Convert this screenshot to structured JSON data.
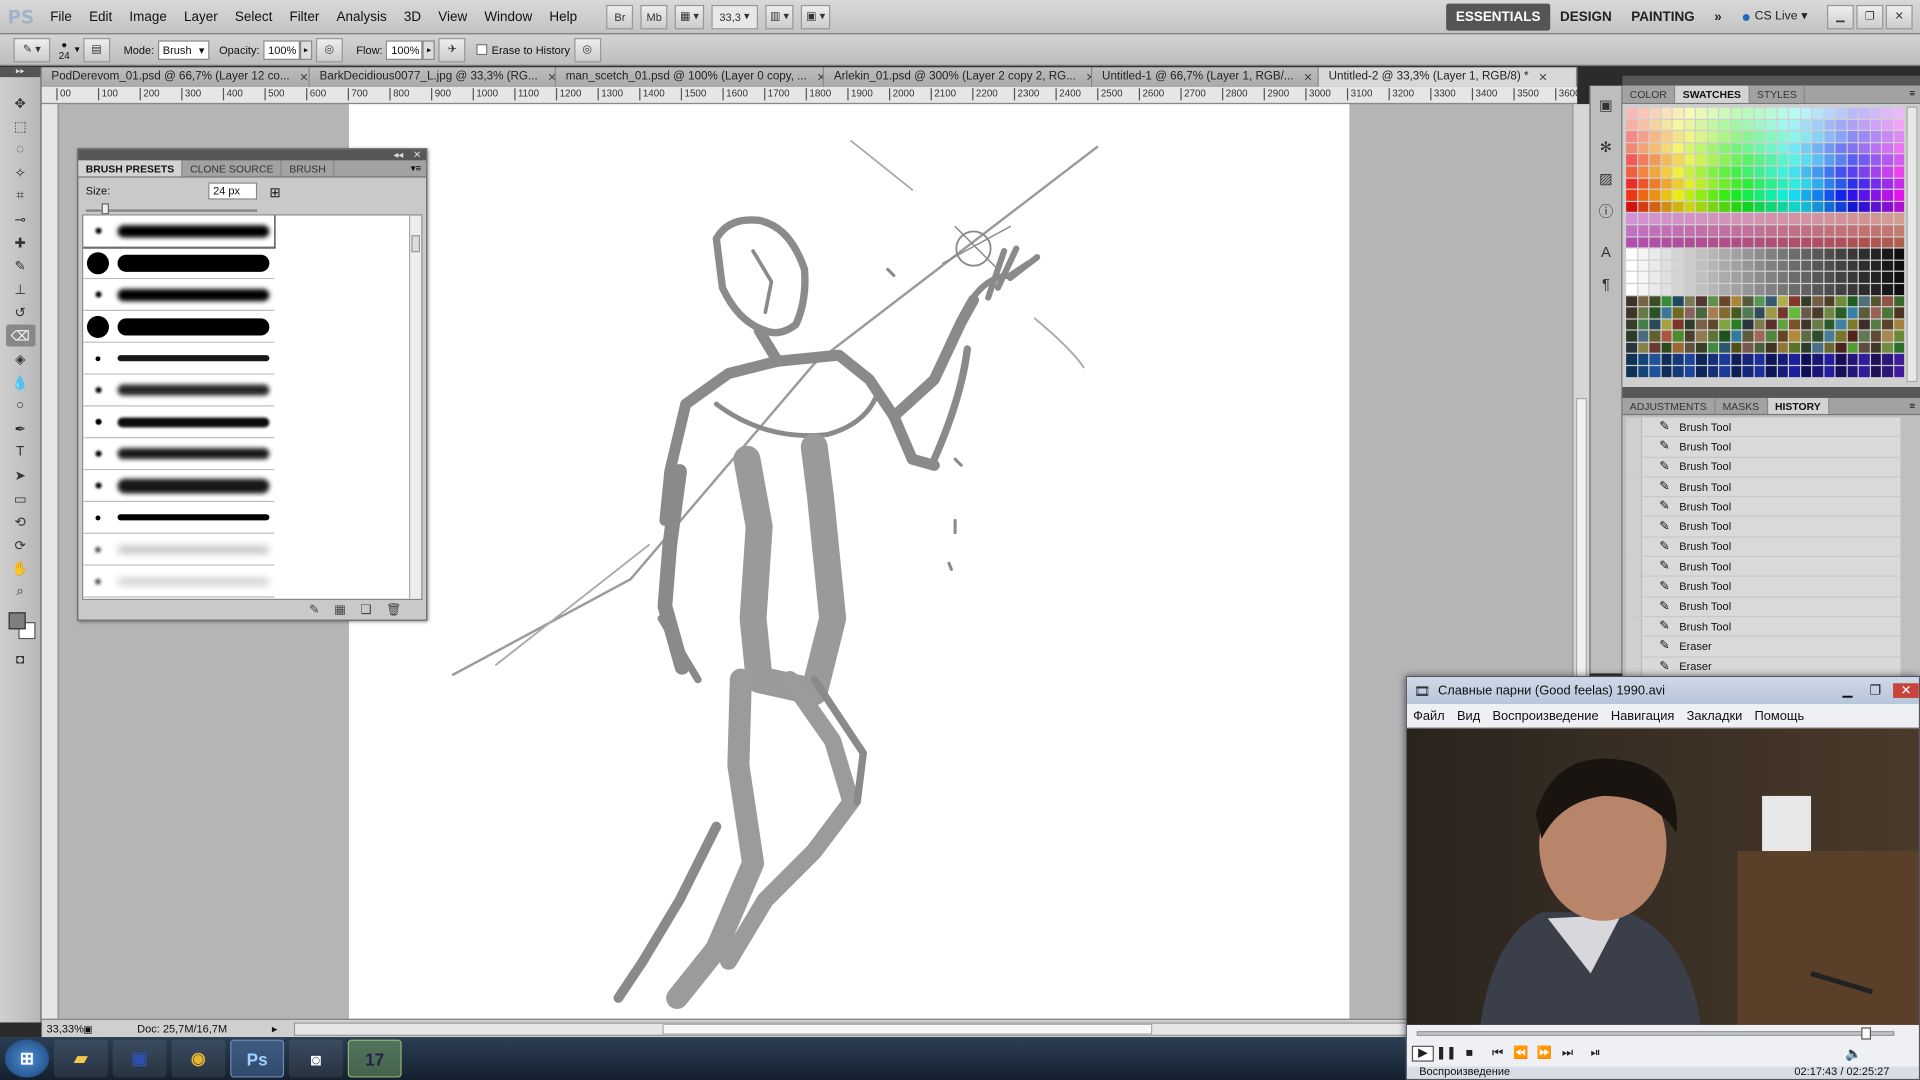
{
  "menubar": {
    "logo": "PS",
    "items": [
      "File",
      "Edit",
      "Image",
      "Layer",
      "Select",
      "Filter",
      "Analysis",
      "3D",
      "View",
      "Window",
      "Help"
    ],
    "bridge": "Br",
    "minibridge": "Mb",
    "zoom": "33,3",
    "workspaces": [
      "ESSENTIALS",
      "DESIGN",
      "PAINTING"
    ],
    "more": "»",
    "cslive": "CS Live"
  },
  "options": {
    "brush_size": "24",
    "mode_label": "Mode:",
    "mode_value": "Brush",
    "opacity_label": "Opacity:",
    "opacity_value": "100%",
    "flow_label": "Flow:",
    "flow_value": "100%",
    "erase_label": "Erase to History"
  },
  "tabs": [
    {
      "label": "PodDerevom_01.psd @ 66,7% (Layer 12 co..."
    },
    {
      "label": "BarkDecidious0077_L.jpg @ 33,3% (RG..."
    },
    {
      "label": "man_scetch_01.psd @ 100% (Layer 0 copy, ..."
    },
    {
      "label": "Arlekin_01.psd @ 300% (Layer 2 copy 2, RG..."
    },
    {
      "label": "Untitled-1 @ 66,7% (Layer 1, RGB/..."
    },
    {
      "label": "Untitled-2 @ 33,3% (Layer 1, RGB/8) *"
    }
  ],
  "ruler_ticks": [
    "00",
    "100",
    "200",
    "300",
    "400",
    "500",
    "600",
    "700",
    "800",
    "900",
    "1000",
    "1100",
    "1200",
    "1300",
    "1400",
    "1500",
    "1600",
    "1700",
    "1800",
    "1900",
    "2000",
    "2100",
    "2200",
    "2300",
    "2400",
    "2500",
    "2600",
    "2700",
    "2800",
    "2900",
    "3000",
    "3100",
    "3200",
    "3300",
    "3400",
    "3500",
    "3600"
  ],
  "status": {
    "zoom": "33,33%",
    "doc": "Doc: 25,7M/16,7M"
  },
  "brush_panel": {
    "tabs": [
      "BRUSH PRESETS",
      "CLONE SOURCE",
      "BRUSH"
    ],
    "size_label": "Size:",
    "size_value": "24 px"
  },
  "swatch_panel": {
    "tabs": [
      "COLOR",
      "SWATCHES",
      "STYLES"
    ]
  },
  "history_panel": {
    "tabs": [
      "ADJUSTMENTS",
      "MASKS",
      "HISTORY"
    ],
    "items": [
      "Brush Tool",
      "Brush Tool",
      "Brush Tool",
      "Brush Tool",
      "Brush Tool",
      "Brush Tool",
      "Brush Tool",
      "Brush Tool",
      "Brush Tool",
      "Brush Tool",
      "Brush Tool",
      "Eraser",
      "Eraser"
    ]
  },
  "player": {
    "title": "Славные парни (Good feelas) 1990.avi",
    "menu": [
      "Файл",
      "Вид",
      "Воспроизведение",
      "Навигация",
      "Закладки",
      "Помощь"
    ],
    "time": "02:17:43 / 02:25:27",
    "status": "Воспроизведение",
    "progress": 0.948
  },
  "taskbar": {
    "ps": "Ps",
    "calendar": "17"
  }
}
